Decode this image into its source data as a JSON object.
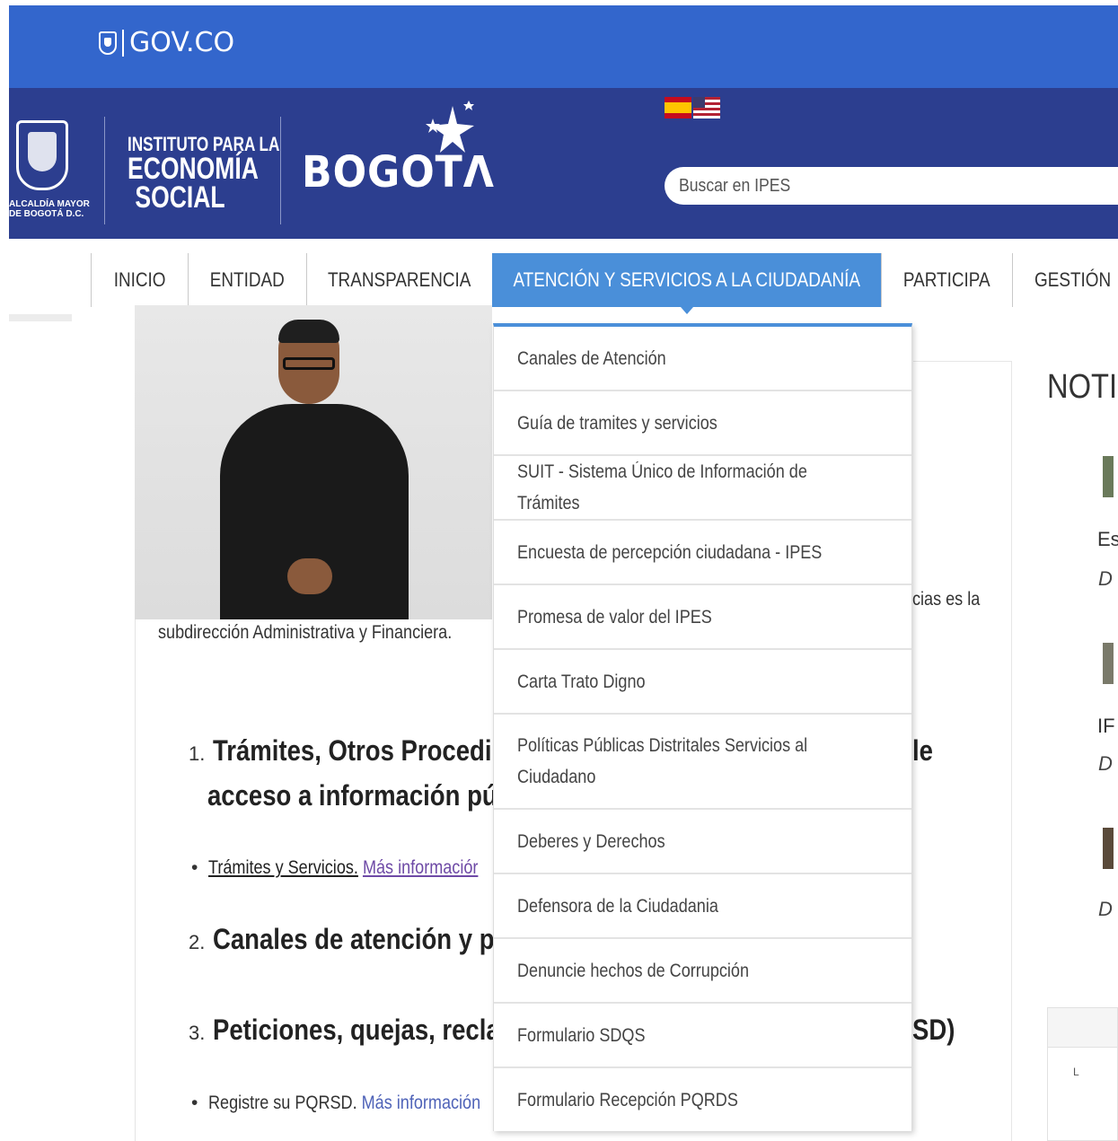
{
  "govbar": {
    "logo_text": "GOV.CO"
  },
  "header": {
    "alcaldia_text": "ALCALDÍA MAYOR\nDE BOGOTÁ D.C.",
    "instituto_line1": "INSTITUTO PARA LA",
    "instituto_line2": "ECONOMÍA",
    "instituto_line3": "SOCIAL",
    "bogota_text": "BOGOT",
    "search_placeholder": "Buscar en IPES"
  },
  "nav": {
    "items": [
      {
        "label": "INICIO"
      },
      {
        "label": "ENTIDAD"
      },
      {
        "label": "TRANSPARENCIA"
      },
      {
        "label": "ATENCIÓN Y SERVICIOS A LA CIUDADANÍA"
      },
      {
        "label": "PARTICIPA"
      },
      {
        "label": "GESTIÓN"
      }
    ],
    "active_index": 3
  },
  "dropdown": {
    "items": [
      {
        "label": "Canales de Atención"
      },
      {
        "label": "Guía de tramites y servicios"
      },
      {
        "label": "SUIT - Sistema Único de Información de Trámites"
      },
      {
        "label": "Encuesta de percepción ciudadana - IPES"
      },
      {
        "label": "Promesa de valor del IPES"
      },
      {
        "label": "Carta Trato Digno"
      },
      {
        "label": "Políticas Públicas Distritales Servicios al Ciudadano"
      },
      {
        "label": "Deberes y Derechos"
      },
      {
        "label": "Defensora de la Ciudadania"
      },
      {
        "label": "Denuncie hechos de Corrupción"
      },
      {
        "label": "Formulario SDQS"
      },
      {
        "label": "Formulario Recepción PQRDS"
      }
    ]
  },
  "content": {
    "caption_right": "cias es la",
    "caption_left": "subdirección Administrativa y Financiera.",
    "h1_num": "1.",
    "h1_line1": "Trámites, Otros Procedim",
    "h1_line1_tail": "le",
    "h1_line2": "acceso a información púl",
    "bullet1_text": "Trámites y Servicios.",
    "bullet1_link": "Más informaciór",
    "h2_num": "2.",
    "h2_text": "Canales de atención y pi",
    "h3_num": "3.",
    "h3_text": "Peticiones, quejas, reclai",
    "h3_tail": "SD)",
    "bullet2_text": "Registre su PQRSD.",
    "bullet2_link": "Más información"
  },
  "sidebar": {
    "title": "NOTI",
    "items": [
      {
        "title": "Es",
        "date": "D"
      },
      {
        "title": "IF",
        "date": "D"
      },
      {
        "title": "",
        "date": "D"
      }
    ],
    "box_label": "L"
  },
  "colors": {
    "govbar_blue": "#3366cc",
    "header_navy": "#2c3e8f",
    "nav_active": "#4a8fd9",
    "link_blue": "#4f63b8"
  }
}
